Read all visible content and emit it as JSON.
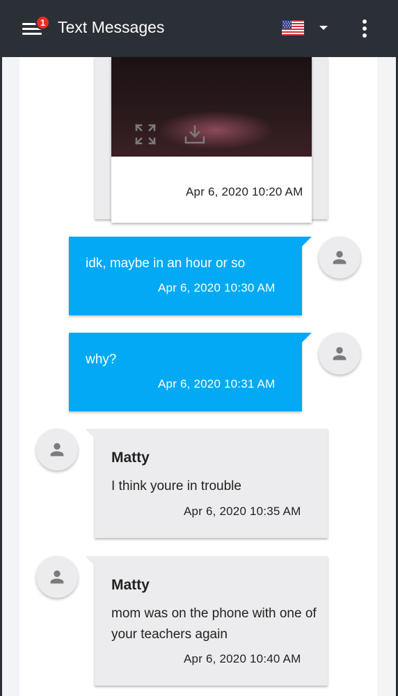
{
  "appbar": {
    "title": "Text Messages",
    "notification_count": "1",
    "icons": [
      "menu-icon",
      "us-flag-icon",
      "dropdown-arrow-icon",
      "more-vert-icon"
    ]
  },
  "colors": {
    "appbar": "#2b2f36",
    "outgoing_bubble": "#03a9f4",
    "incoming_bubble": "#ececee",
    "badge": "#ef2b20"
  },
  "media_message": {
    "icons": [
      "fullscreen-icon",
      "download-icon"
    ],
    "timestamp": "Apr 6, 2020 10:20 AM"
  },
  "messages": [
    {
      "direction": "outgoing",
      "text": "idk, maybe in an hour or so",
      "timestamp": "Apr 6, 2020 10:30 AM"
    },
    {
      "direction": "outgoing",
      "text": "why?",
      "timestamp": "Apr 6, 2020 10:31 AM"
    },
    {
      "direction": "incoming",
      "sender": "Matty",
      "text": "I think youre in trouble",
      "timestamp": "Apr 6, 2020 10:35 AM"
    },
    {
      "direction": "incoming",
      "sender": "Matty",
      "text": "mom was on the phone with one of your teachers again",
      "timestamp": "Apr 6, 2020 10:40 AM"
    }
  ]
}
